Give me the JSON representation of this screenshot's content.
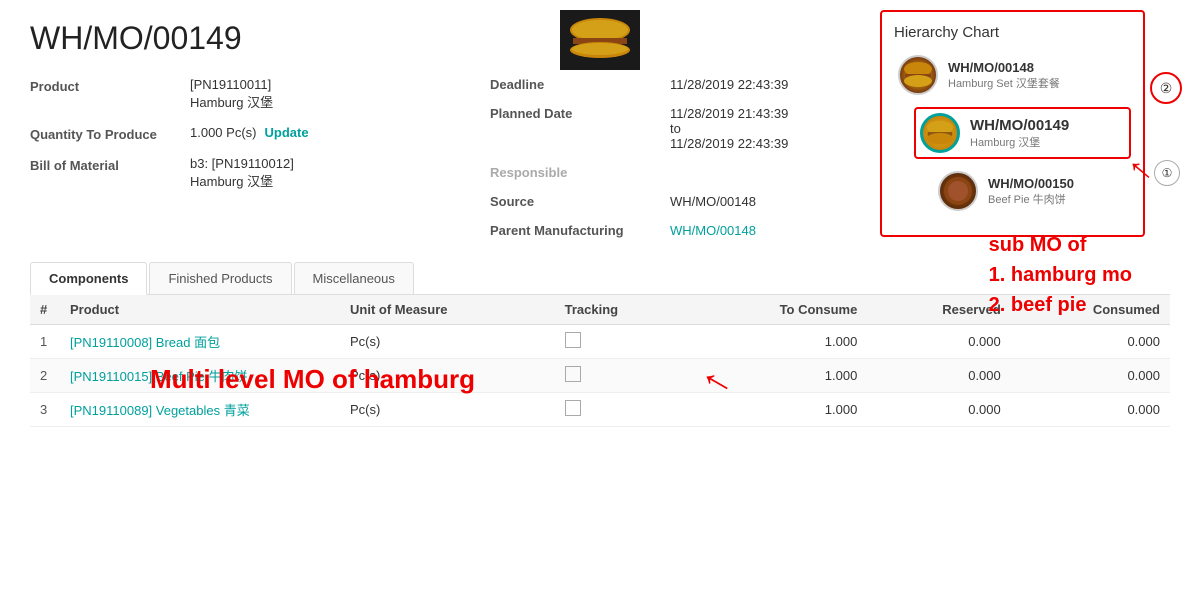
{
  "title": "WH/MO/00149",
  "form": {
    "product_label": "Product",
    "product_value": "[PN19110011]\nHamburg 汉堡",
    "product_link1": "[PN19110011]",
    "product_link2": "Hamburg 汉堡",
    "qty_label": "Quantity To Produce",
    "qty_value": "1.000 Pc(s)",
    "update_btn": "Update",
    "bom_label": "Bill of Material",
    "bom_link1": "b3: [PN19110012]",
    "bom_link2": "Hamburg 汉堡",
    "deadline_label": "Deadline",
    "deadline_value": "11/28/2019 22:43:39",
    "planned_label": "Planned Date",
    "planned_value1": "11/28/2019 21:43:39",
    "planned_value2": "to",
    "planned_value3": "11/28/2019 22:43:39",
    "responsible_label": "Responsible",
    "source_label": "Source",
    "source_value": "WH/MO/00148",
    "parent_label": "Parent Manufacturing",
    "parent_value": "WH/MO/00148"
  },
  "hierarchy": {
    "title": "Hierarchy Chart",
    "items": [
      {
        "mo": "WH/MO/00148",
        "name": "Hamburg Set 汉堡套餐",
        "active": false,
        "color1": "#c8860a",
        "color2": "#8b4513"
      },
      {
        "mo": "WH/MO/00149",
        "name": "Hamburg 汉堡",
        "active": true,
        "color1": "#d4a017",
        "color2": "#c8860a"
      },
      {
        "mo": "WH/MO/00150",
        "name": "Beef Pie 牛肉饼",
        "active": false,
        "color1": "#8b4513",
        "color2": "#5c2d0a"
      }
    ]
  },
  "badge2": "②",
  "badge1": "①",
  "annotation_main": "Multi level MO of  hamburg",
  "annotation_sub_line1": "sub MO of",
  "annotation_sub_line2": "1. hamburg mo",
  "annotation_sub_line3": "2. beef pie",
  "tabs": [
    {
      "label": "Components",
      "active": true
    },
    {
      "label": "Finished Products",
      "active": false
    },
    {
      "label": "Miscellaneous",
      "active": false
    }
  ],
  "table": {
    "headers": [
      "#",
      "Product",
      "Unit of Measure",
      "Tracking",
      "To Consume",
      "Reserved",
      "Consumed"
    ],
    "rows": [
      {
        "num": "1",
        "product": "[PN19110008] Bread 面包",
        "uom": "Pc(s)",
        "tracking": "",
        "to_consume": "1.000",
        "reserved": "0.000",
        "consumed": "0.000"
      },
      {
        "num": "2",
        "product": "[PN19110015] Beef Pie 牛肉饼",
        "uom": "Pc(s)",
        "tracking": "",
        "to_consume": "1.000",
        "reserved": "0.000",
        "consumed": "0.000"
      },
      {
        "num": "3",
        "product": "[PN19110089] Vegetables 青菜",
        "uom": "Pc(s)",
        "tracking": "",
        "to_consume": "1.000",
        "reserved": "0.000",
        "consumed": "0.000"
      }
    ]
  }
}
